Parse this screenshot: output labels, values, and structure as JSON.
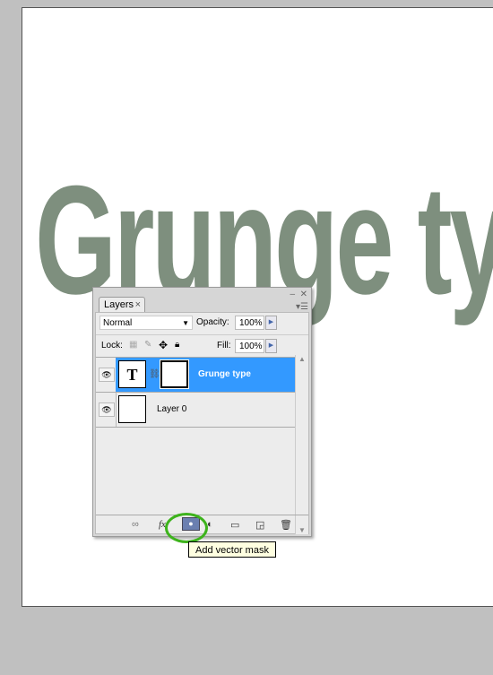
{
  "canvas": {
    "text": "Grunge type",
    "text_color": "#7e8f7e"
  },
  "panel": {
    "tab": "Layers",
    "blend_mode": "Normal",
    "opacity_label": "Opacity:",
    "opacity": "100%",
    "lock_label": "Lock:",
    "fill_label": "Fill:",
    "fill": "100%",
    "layers": [
      {
        "name": "Grunge type",
        "type": "text",
        "thumb": "T",
        "selected": true,
        "visible": true
      },
      {
        "name": "Layer 0",
        "type": "raster",
        "visible": true
      }
    ],
    "bottom_icons": [
      "link-layers-icon",
      "fx-icon",
      "add-vector-mask-icon",
      "adjustment-layer-icon",
      "new-group-icon",
      "new-layer-icon",
      "trash-icon"
    ]
  },
  "tooltip": "Add vector mask",
  "highlight_color": "#3399ff"
}
